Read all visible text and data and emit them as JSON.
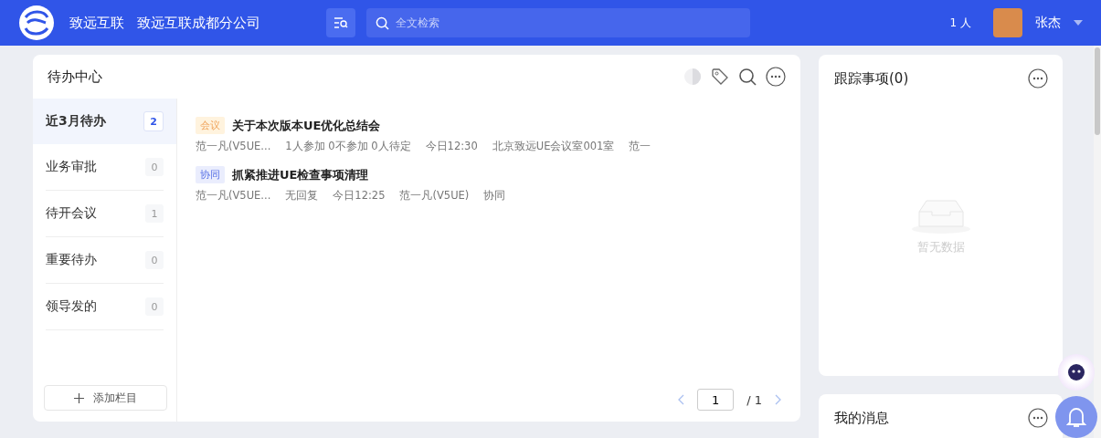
{
  "header": {
    "brand": "致远互联",
    "company": "致远互联成都分公司",
    "search": {
      "placeholder": "全文检索"
    },
    "online": "1 人",
    "user": "张杰"
  },
  "todo": {
    "title": "待办中心",
    "tabs": [
      {
        "label": "近3月待办",
        "count": "2",
        "selected": true
      },
      {
        "label": "业务审批",
        "count": "0",
        "selected": false
      },
      {
        "label": "待开会议",
        "count": "1",
        "selected": false
      },
      {
        "label": "重要待办",
        "count": "0",
        "selected": false
      },
      {
        "label": "领导发的",
        "count": "0",
        "selected": false
      }
    ],
    "add_button": "添加栏目",
    "items": [
      {
        "kind": "meeting",
        "tag": "会议",
        "title": "关于本次版本UE优化总结会",
        "meta": [
          "范一凡(V5UE...",
          "1人参加 0不参加 0人待定",
          "今日12:30",
          "北京致远UE会议室001室",
          "范一"
        ]
      },
      {
        "kind": "collab",
        "tag": "协同",
        "title": "抓紧推进UE检查事项清理",
        "meta": [
          "范一凡(V5UE...",
          "无回复",
          "今日12:25",
          "范一凡(V5UE)",
          "协同"
        ]
      }
    ],
    "pagination": {
      "page": "1",
      "total": "/ 1"
    }
  },
  "tracking": {
    "title": "跟踪事项(0)",
    "empty": "暂无数据"
  },
  "messages": {
    "title": "我的消息"
  }
}
